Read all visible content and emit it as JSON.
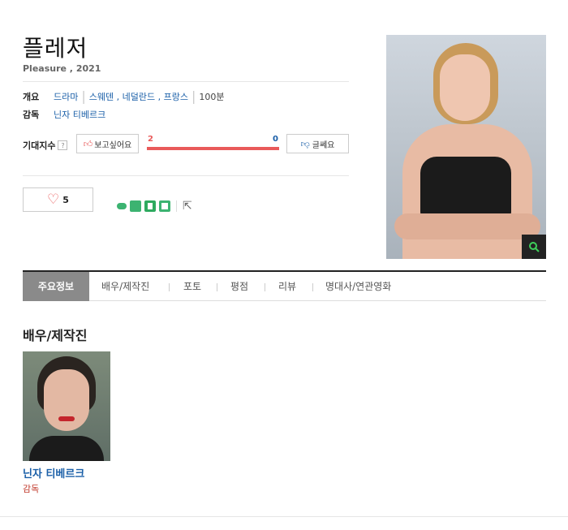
{
  "movie": {
    "title": "플레저",
    "subtitle": "Pleasure , 2021"
  },
  "overview": {
    "label": "개요",
    "genre": "드라마",
    "countries": "스웨덴 , 네덜란드 , 프랑스",
    "runtime": "100분"
  },
  "director": {
    "label": "감독",
    "name": "닌자 티베르크"
  },
  "anticipation": {
    "label": "기대지수",
    "help": "?",
    "want_label": "보고싶어요",
    "want_count": "2",
    "meh_count": "0",
    "meh_label": "글쎄요",
    "want_fraction": 1.0
  },
  "like": {
    "count": "5"
  },
  "tabs": [
    {
      "label": "주요정보"
    },
    {
      "label": "배우/제작진"
    },
    {
      "label": "포토"
    },
    {
      "label": "평점"
    },
    {
      "label": "리뷰"
    },
    {
      "label": "명대사/연관영화"
    }
  ],
  "cast_section": {
    "heading": "배우/제작진",
    "people": [
      {
        "name": "닌자 티베르크",
        "role": "감독"
      }
    ]
  },
  "colors": {
    "accent_red": "#e95a5a",
    "link_blue": "#1a5fa8",
    "share_green": "#3cb371"
  }
}
